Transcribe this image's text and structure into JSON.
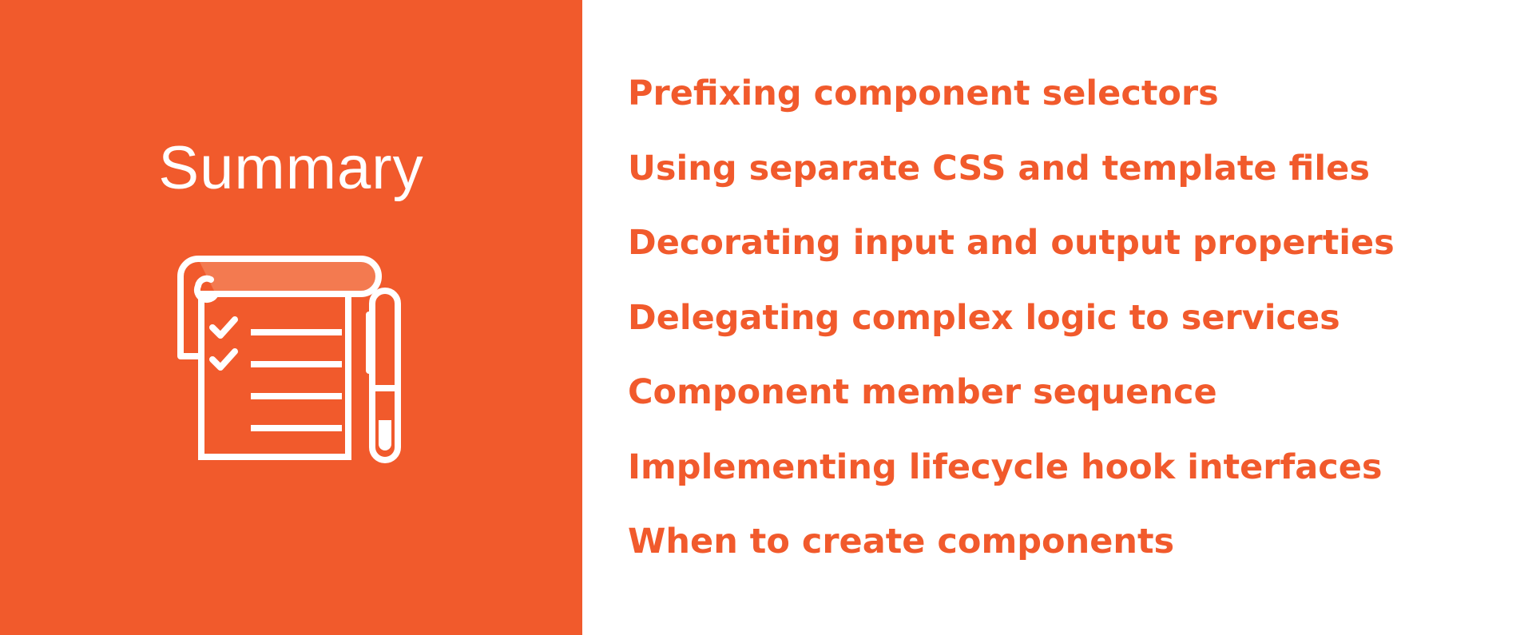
{
  "slide": {
    "title": "Summary",
    "icon": "checklist-with-pen-icon",
    "colors": {
      "accent": "#f15a2c",
      "accent_light": "#f37a50",
      "background": "#ffffff",
      "title_text": "#ffffff"
    },
    "topics": [
      "Prefixing component selectors",
      "Using separate CSS and template files",
      "Decorating input and output properties",
      "Delegating complex logic to services",
      "Component member sequence",
      "Implementing lifecycle hook interfaces",
      "When to create components"
    ]
  }
}
